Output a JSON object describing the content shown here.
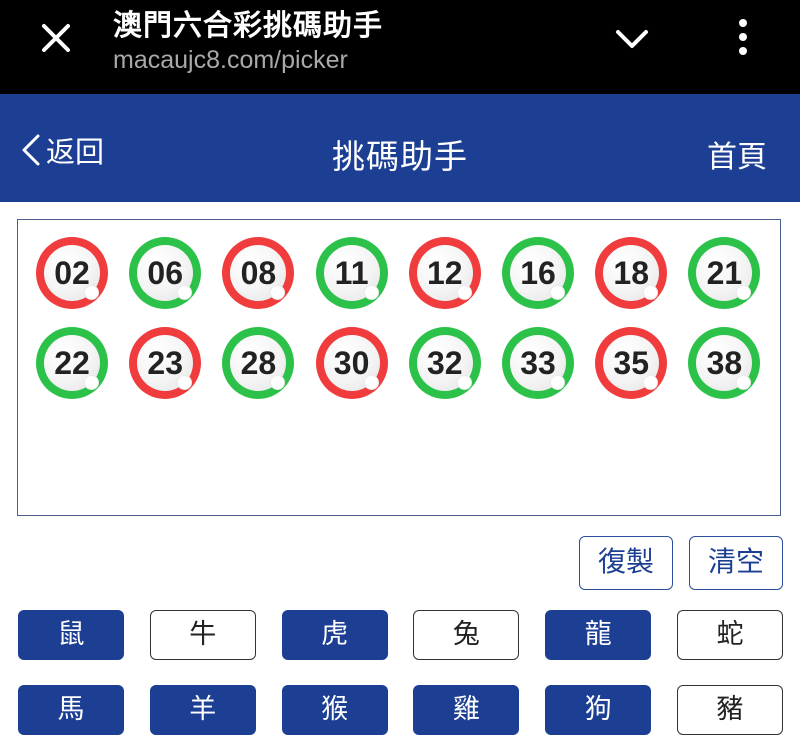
{
  "browser": {
    "title": "澳門六合彩挑碼助手",
    "url": "macaujc8.com/picker",
    "close_icon": "close-icon",
    "chevron_icon": "chevron-down-icon",
    "more_icon": "more-vert-icon"
  },
  "header": {
    "back_label": "返回",
    "title": "挑碼助手",
    "home_label": "首頁",
    "background": "#1c3f93"
  },
  "picked": {
    "balls": [
      {
        "number": "02",
        "color": "red"
      },
      {
        "number": "06",
        "color": "green"
      },
      {
        "number": "08",
        "color": "red"
      },
      {
        "number": "11",
        "color": "green"
      },
      {
        "number": "12",
        "color": "red"
      },
      {
        "number": "16",
        "color": "green"
      },
      {
        "number": "18",
        "color": "red"
      },
      {
        "number": "21",
        "color": "green"
      },
      {
        "number": "22",
        "color": "green"
      },
      {
        "number": "23",
        "color": "red"
      },
      {
        "number": "28",
        "color": "green"
      },
      {
        "number": "30",
        "color": "red"
      },
      {
        "number": "32",
        "color": "green"
      },
      {
        "number": "33",
        "color": "green"
      },
      {
        "number": "35",
        "color": "red"
      },
      {
        "number": "38",
        "color": "green"
      }
    ],
    "colors": {
      "red": "#f03c3c",
      "green": "#2cc24a"
    }
  },
  "actions": {
    "copy_label": "復製",
    "clear_label": "清空"
  },
  "zodiac": [
    {
      "label": "鼠",
      "selected": true
    },
    {
      "label": "牛",
      "selected": false
    },
    {
      "label": "虎",
      "selected": true
    },
    {
      "label": "兔",
      "selected": false
    },
    {
      "label": "龍",
      "selected": true
    },
    {
      "label": "蛇",
      "selected": false
    },
    {
      "label": "馬",
      "selected": true
    },
    {
      "label": "羊",
      "selected": true
    },
    {
      "label": "猴",
      "selected": true
    },
    {
      "label": "雞",
      "selected": true
    },
    {
      "label": "狗",
      "selected": true
    },
    {
      "label": "豬",
      "selected": false
    }
  ]
}
